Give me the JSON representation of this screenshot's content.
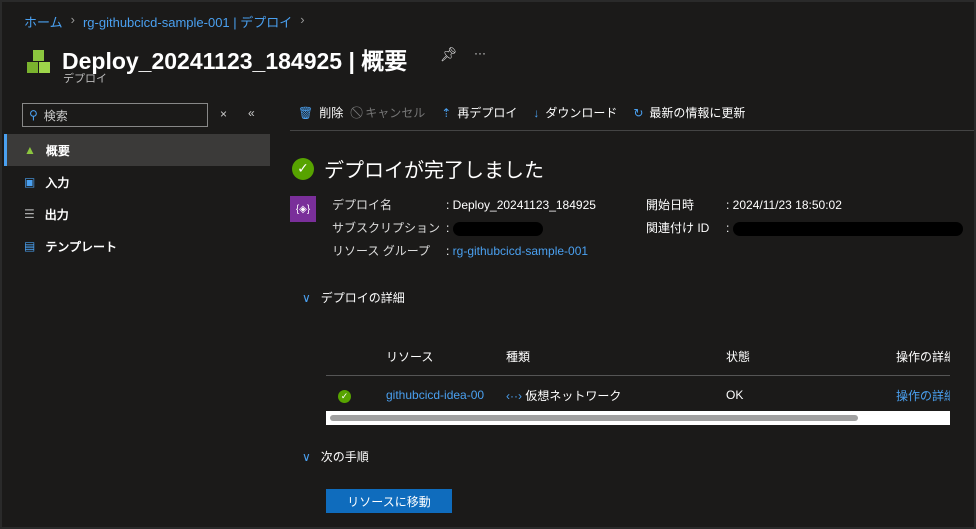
{
  "breadcrumb": [
    "ホーム",
    "rg-githubcicd-sample-001 | デプロイ"
  ],
  "header": {
    "title": "Deploy_20241123_184925 | 概要",
    "subtitle": "デプロイ",
    "more": "···"
  },
  "search": {
    "placeholder": "検索"
  },
  "sidebar": {
    "items": [
      {
        "label": "概要",
        "icon": "overview-icon"
      },
      {
        "label": "入力",
        "icon": "input-icon"
      },
      {
        "label": "出力",
        "icon": "output-icon"
      },
      {
        "label": "テンプレート",
        "icon": "template-icon"
      }
    ]
  },
  "toolbar": {
    "delete": "削除",
    "cancel": "キャンセル",
    "redeploy": "再デプロイ",
    "download": "ダウンロード",
    "refresh": "最新の情報に更新"
  },
  "status": "デプロイが完了しました",
  "info": {
    "deploy_name_label": "デプロイ名",
    "deploy_name": "Deploy_20241123_184925",
    "subscription_label": "サブスクリプション",
    "rg_label": "リソース グループ",
    "rg": "rg-githubcicd-sample-001",
    "start_label": "開始日時",
    "start": "2024/11/23 18:50:02",
    "corr_label": "関連付け ID"
  },
  "details": {
    "title": "デプロイの詳細",
    "headers": [
      "リソース",
      "種類",
      "状態",
      "操作の詳細"
    ],
    "rows": [
      {
        "resource": "githubcicd-idea-00",
        "type": "仮想ネットワーク",
        "state": "OK",
        "op": "操作の詳細"
      }
    ]
  },
  "next": {
    "title": "次の手順",
    "button": "リソースに移動"
  }
}
